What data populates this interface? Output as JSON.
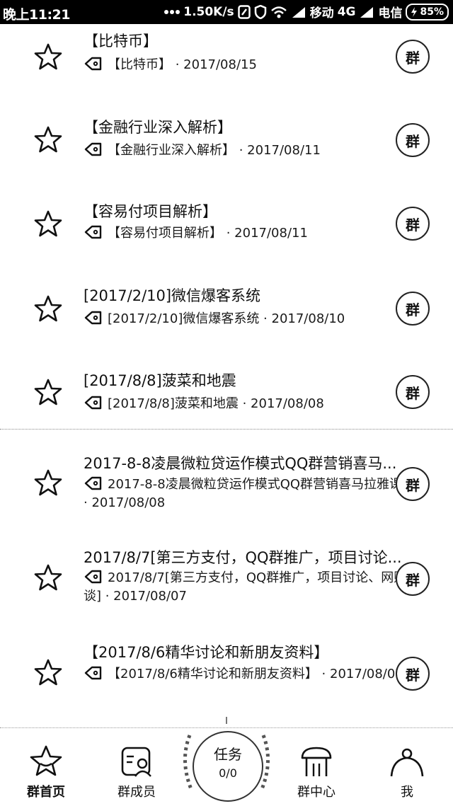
{
  "status_bar": {
    "time": "晚上11:21",
    "net_speed": "1.50K/s",
    "carrier1": "移动",
    "network": "4G",
    "carrier2": "电信",
    "battery": "85%"
  },
  "items": [
    {
      "title": "【比特币】",
      "meta": "【比特币】 · 2017/08/15",
      "group_label": "群"
    },
    {
      "title": "【金融行业深入解析】",
      "meta": "【金融行业深入解析】 · 2017/08/11",
      "group_label": "群"
    },
    {
      "title": "【容易付项目解析】",
      "meta": "【容易付项目解析】 · 2017/08/11",
      "group_label": "群"
    },
    {
      "title": "[2017/2/10]微信爆客系统",
      "meta": "[2017/2/10]微信爆客系统 · 2017/08/10",
      "group_label": "群"
    },
    {
      "title": "[2017/8/8]菠菜和地震",
      "meta": "[2017/8/8]菠菜和地震 · 2017/08/08",
      "group_label": "群"
    },
    {
      "title": "2017-8-8凌晨微粒贷运作模式QQ群营销喜马...",
      "meta": "2017-8-8凌晨微粒贷运作模式QQ群营销喜马拉雅课程 · 2017/08/08",
      "group_label": "群"
    },
    {
      "title": "2017/8/7[第三方支付，QQ群推广，项目讨论...",
      "meta": "2017/8/7[第三方支付，QQ群推广，项目讨论、网赚杂谈] · 2017/08/07",
      "group_label": "群"
    },
    {
      "title": "【2017/8/6精华讨论和新朋友资料】",
      "meta": "【2017/8/6精华讨论和新朋友资料】 · 2017/08/07",
      "group_label": "群"
    }
  ],
  "tabbar": {
    "home": "群首页",
    "members": "群成员",
    "task_label": "任务",
    "task_count": "0/0",
    "center": "群中心",
    "me": "我"
  },
  "icons": {
    "star": "star-outline-icon",
    "tag": "tag-icon",
    "home": "group-home-icon",
    "members": "member-card-icon",
    "center": "shop-awning-icon",
    "me": "person-icon"
  }
}
